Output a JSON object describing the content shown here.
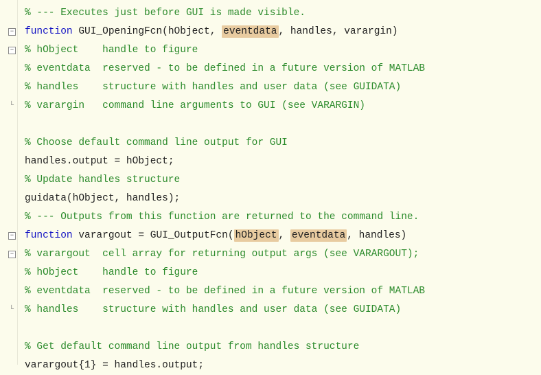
{
  "lines": [
    {
      "gutter": "",
      "segments": [
        {
          "cls": "comment",
          "t": "% --- Executes just before GUI is made visible."
        }
      ]
    },
    {
      "gutter": "fold",
      "segments": [
        {
          "cls": "keyword",
          "t": "function"
        },
        {
          "cls": "text",
          "t": " GUI_OpeningFcn(hObject, "
        },
        {
          "cls": "text highlight",
          "t": "eventdata"
        },
        {
          "cls": "text",
          "t": ", handles, varargin)"
        }
      ]
    },
    {
      "gutter": "fold",
      "segments": [
        {
          "cls": "comment",
          "t": "% hObject    handle to figure"
        }
      ]
    },
    {
      "gutter": "",
      "segments": [
        {
          "cls": "comment",
          "t": "% eventdata  reserved - to be defined in a future version of MATLAB"
        }
      ]
    },
    {
      "gutter": "",
      "segments": [
        {
          "cls": "comment",
          "t": "% handles    structure with handles and user data (see GUIDATA)"
        }
      ]
    },
    {
      "gutter": "end",
      "segments": [
        {
          "cls": "comment",
          "t": "% varargin   command line arguments to GUI (see VARARGIN)"
        }
      ]
    },
    {
      "gutter": "",
      "segments": [
        {
          "cls": "text",
          "t": ""
        }
      ]
    },
    {
      "gutter": "",
      "segments": [
        {
          "cls": "comment",
          "t": "% Choose default command line output for GUI"
        }
      ]
    },
    {
      "gutter": "",
      "segments": [
        {
          "cls": "text",
          "t": "handles.output = hObject;"
        }
      ]
    },
    {
      "gutter": "",
      "segments": [
        {
          "cls": "comment",
          "t": "% Update handles structure"
        }
      ]
    },
    {
      "gutter": "",
      "segments": [
        {
          "cls": "text",
          "t": "guidata(hObject, handles);"
        }
      ]
    },
    {
      "gutter": "",
      "segments": [
        {
          "cls": "comment",
          "t": "% --- Outputs from this function are returned to the command line."
        }
      ]
    },
    {
      "gutter": "fold",
      "segments": [
        {
          "cls": "keyword",
          "t": "function"
        },
        {
          "cls": "text",
          "t": " varargout = GUI_OutputFcn("
        },
        {
          "cls": "text highlight",
          "t": "hObject"
        },
        {
          "cls": "text",
          "t": ", "
        },
        {
          "cls": "text highlight",
          "t": "eventdata"
        },
        {
          "cls": "text",
          "t": ", handles)"
        }
      ]
    },
    {
      "gutter": "fold",
      "segments": [
        {
          "cls": "comment",
          "t": "% varargout  cell array for returning output args (see VARARGOUT);"
        }
      ]
    },
    {
      "gutter": "",
      "segments": [
        {
          "cls": "comment",
          "t": "% hObject    handle to figure"
        }
      ]
    },
    {
      "gutter": "",
      "segments": [
        {
          "cls": "comment",
          "t": "% eventdata  reserved - to be defined in a future version of MATLAB"
        }
      ]
    },
    {
      "gutter": "end",
      "segments": [
        {
          "cls": "comment",
          "t": "% handles    structure with handles and user data (see GUIDATA)"
        }
      ]
    },
    {
      "gutter": "",
      "segments": [
        {
          "cls": "text",
          "t": ""
        }
      ]
    },
    {
      "gutter": "",
      "segments": [
        {
          "cls": "comment",
          "t": "% Get default command line output from handles structure"
        }
      ]
    },
    {
      "gutter": "",
      "segments": [
        {
          "cls": "text",
          "t": "varargout{1} = handles.output;"
        }
      ]
    }
  ],
  "fold_minus": "−",
  "fold_end_marker": "└"
}
